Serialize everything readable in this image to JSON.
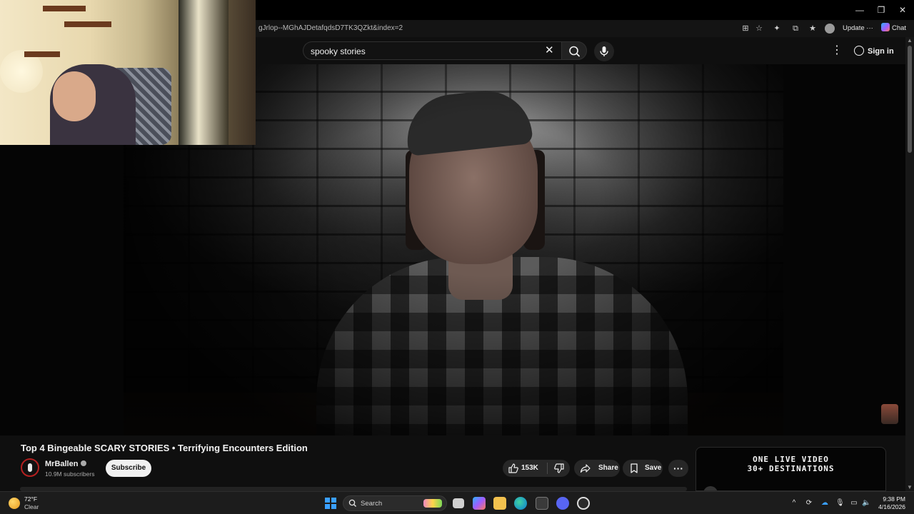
{
  "browser": {
    "url": "gJrlop--MGhAJDetafqdsD7TK3QZkt&index=2",
    "update_label": "Update",
    "update_more": "···",
    "chat_label": "Chat",
    "window_controls": {
      "minimize": "—",
      "restore": "❐",
      "close": "✕"
    }
  },
  "youtube": {
    "search": {
      "query": "spooky stories",
      "clear": "✕"
    },
    "header": {
      "menu_icon": "⋮",
      "signin_label": "Sign in"
    },
    "video": {
      "title": "Top 4 Bingeable SCARY STORIES • Terrifying Encounters Edition",
      "channel": "MrBallen",
      "subscribers": "10.9M subscribers",
      "subscribe_label": "Subscribe",
      "likes": "153K",
      "share_label": "Share",
      "save_label": "Save",
      "more_label": "···"
    },
    "ad": {
      "line1": "ONE LIVE VIDEO",
      "line2": "30+ DESTINATIONS"
    }
  },
  "taskbar": {
    "weather": {
      "temp": "72°F",
      "condition": "Clear"
    },
    "search_placeholder": "Search",
    "time": "9:38 PM",
    "date": "4/16/2026",
    "tray_chevron": "^"
  },
  "colors": {
    "page_bg": "#0f0f0f",
    "pill_bg": "#272727",
    "subscribe_bg": "#f1f1f1",
    "accent_blue": "#3aa0ff"
  },
  "icons": [
    "minimize-icon",
    "restore-icon",
    "close-icon",
    "apps-icon",
    "star-icon",
    "extensions-icon",
    "collections-icon",
    "favorites-icon",
    "profile-icon",
    "copilot-icon",
    "clear-icon",
    "search-icon",
    "mic-icon",
    "more-vert-icon",
    "account-icon",
    "verified-icon",
    "like-icon",
    "dislike-icon",
    "share-icon",
    "bookmark-icon",
    "more-horiz-icon",
    "weather-icon",
    "windows-start-icon",
    "taskbar-search-icon",
    "task-view-icon",
    "copilot-app-icon",
    "file-explorer-icon",
    "edge-icon",
    "store-icon",
    "discord-icon",
    "obs-icon",
    "tray-chevron-icon",
    "network-icon",
    "volume-icon"
  ]
}
